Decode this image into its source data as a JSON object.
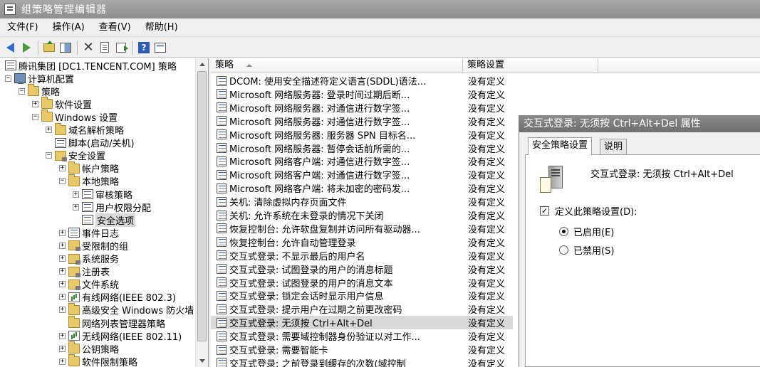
{
  "window": {
    "title": "组策略管理编辑器"
  },
  "menu": [
    "文件(F)",
    "操作(A)",
    "查看(V)",
    "帮助(H)"
  ],
  "toolbar": [
    "back-icon",
    "forward-icon",
    "up-folder-icon",
    "show-hide-tree-icon",
    "delete-icon",
    "properties-icon",
    "export-list-icon",
    "help-icon",
    "console-icon"
  ],
  "tree": [
    {
      "label": "腾讯集团 [DC1.TENCENT.COM] 策略",
      "level": 0,
      "exp": "",
      "icon": "policy"
    },
    {
      "label": "计算机配置",
      "level": 0,
      "exp": "−",
      "icon": "computer"
    },
    {
      "label": "策略",
      "level": 1,
      "exp": "−",
      "icon": "folder"
    },
    {
      "label": "软件设置",
      "level": 2,
      "exp": "+",
      "icon": "folder"
    },
    {
      "label": "Windows 设置",
      "level": 2,
      "exp": "−",
      "icon": "folder"
    },
    {
      "label": "域名解析策略",
      "level": 3,
      "exp": "+",
      "icon": "folder"
    },
    {
      "label": "脚本(启动/关机)",
      "level": 3,
      "exp": "",
      "icon": "policy"
    },
    {
      "label": "安全设置",
      "level": 3,
      "exp": "−",
      "icon": "lockfolder"
    },
    {
      "label": "帐户策略",
      "level": 4,
      "exp": "+",
      "icon": "folder"
    },
    {
      "label": "本地策略",
      "level": 4,
      "exp": "−",
      "icon": "folder"
    },
    {
      "label": "审核策略",
      "level": 5,
      "exp": "+",
      "icon": "policy"
    },
    {
      "label": "用户权限分配",
      "level": 5,
      "exp": "+",
      "icon": "policy"
    },
    {
      "label": "安全选项",
      "level": 5,
      "exp": "",
      "icon": "policy",
      "selected": true
    },
    {
      "label": "事件日志",
      "level": 4,
      "exp": "+",
      "icon": "policy"
    },
    {
      "label": "受限制的组",
      "level": 4,
      "exp": "+",
      "icon": "lockfolder"
    },
    {
      "label": "系统服务",
      "level": 4,
      "exp": "+",
      "icon": "lockfolder"
    },
    {
      "label": "注册表",
      "level": 4,
      "exp": "+",
      "icon": "lockfolder"
    },
    {
      "label": "文件系统",
      "level": 4,
      "exp": "+",
      "icon": "lockfolder"
    },
    {
      "label": "有线网络(IEEE 802.3)",
      "level": 4,
      "exp": "+",
      "icon": "bars"
    },
    {
      "label": "高级安全 Windows 防火墙",
      "level": 4,
      "exp": "+",
      "icon": "folder"
    },
    {
      "label": "网络列表管理器策略",
      "level": 4,
      "exp": "",
      "icon": "folder"
    },
    {
      "label": "无线网络(IEEE 802.11)",
      "level": 4,
      "exp": "+",
      "icon": "bars"
    },
    {
      "label": "公钥策略",
      "level": 4,
      "exp": "+",
      "icon": "folder"
    },
    {
      "label": "软件限制策略",
      "level": 4,
      "exp": "+",
      "icon": "folder"
    }
  ],
  "list": {
    "headers": {
      "policy": "策略",
      "setting": "策略设置"
    },
    "rows": [
      {
        "name": "DCOM: 使用安全描述符定义语言(SDDL)语法...",
        "value": "没有定义"
      },
      {
        "name": "Microsoft 网络服务器: 登录时间过期后断...",
        "value": "没有定义"
      },
      {
        "name": "Microsoft 网络服务器: 对通信进行数字签...",
        "value": "没有定义"
      },
      {
        "name": "Microsoft 网络服务器: 对通信进行数字签...",
        "value": "没有定义"
      },
      {
        "name": "Microsoft 网络服务器: 服务器 SPN 目标名...",
        "value": "没有定义"
      },
      {
        "name": "Microsoft 网络服务器: 暂停会话前所需的...",
        "value": "没有定义"
      },
      {
        "name": "Microsoft 网络客户端: 对通信进行数字签...",
        "value": "没有定义"
      },
      {
        "name": "Microsoft 网络客户端: 对通信进行数字签...",
        "value": "没有定义"
      },
      {
        "name": "Microsoft 网络客户端: 将未加密的密码发...",
        "value": "没有定义"
      },
      {
        "name": "关机: 清除虚拟内存页面文件",
        "value": "没有定义"
      },
      {
        "name": "关机: 允许系统在未登录的情况下关闭",
        "value": "没有定义"
      },
      {
        "name": "恢复控制台: 允许软盘复制并访问所有驱动器...",
        "value": "没有定义"
      },
      {
        "name": "恢复控制台: 允许自动管理登录",
        "value": "没有定义"
      },
      {
        "name": "交互式登录: 不显示最后的用户名",
        "value": "没有定义"
      },
      {
        "name": "交互式登录: 试图登录的用户的消息标题",
        "value": "没有定义"
      },
      {
        "name": "交互式登录: 试图登录的用户的消息文本",
        "value": "没有定义"
      },
      {
        "name": "交互式登录: 锁定会话时显示用户信息",
        "value": "没有定义"
      },
      {
        "name": "交互式登录: 提示用户在过期之前更改密码",
        "value": "没有定义"
      },
      {
        "name": "交互式登录: 无须按 Ctrl+Alt+Del",
        "value": "没有定义",
        "selected": true
      },
      {
        "name": "交互式登录: 需要域控制器身份验证以对工作...",
        "value": "没有定义"
      },
      {
        "name": "交互式登录: 需要智能卡",
        "value": "没有定义"
      },
      {
        "name": "交互式登录: 之前登录到缓存的次数(域控制",
        "value": "没有定义"
      }
    ]
  },
  "dialog": {
    "title": "交互式登录: 无须按 Ctrl+Alt+Del 属性",
    "tabs": [
      "安全策略设置",
      "说明"
    ],
    "policy_name": "交互式登录: 无须按 Ctrl+Alt+Del",
    "define_checkbox": {
      "label": "定义此策略设置(D):",
      "checked": true,
      "mark": "✓"
    },
    "radio_enabled": {
      "label": "已启用(E)",
      "selected": true
    },
    "radio_disabled": {
      "label": "已禁用(S)",
      "selected": false
    }
  }
}
